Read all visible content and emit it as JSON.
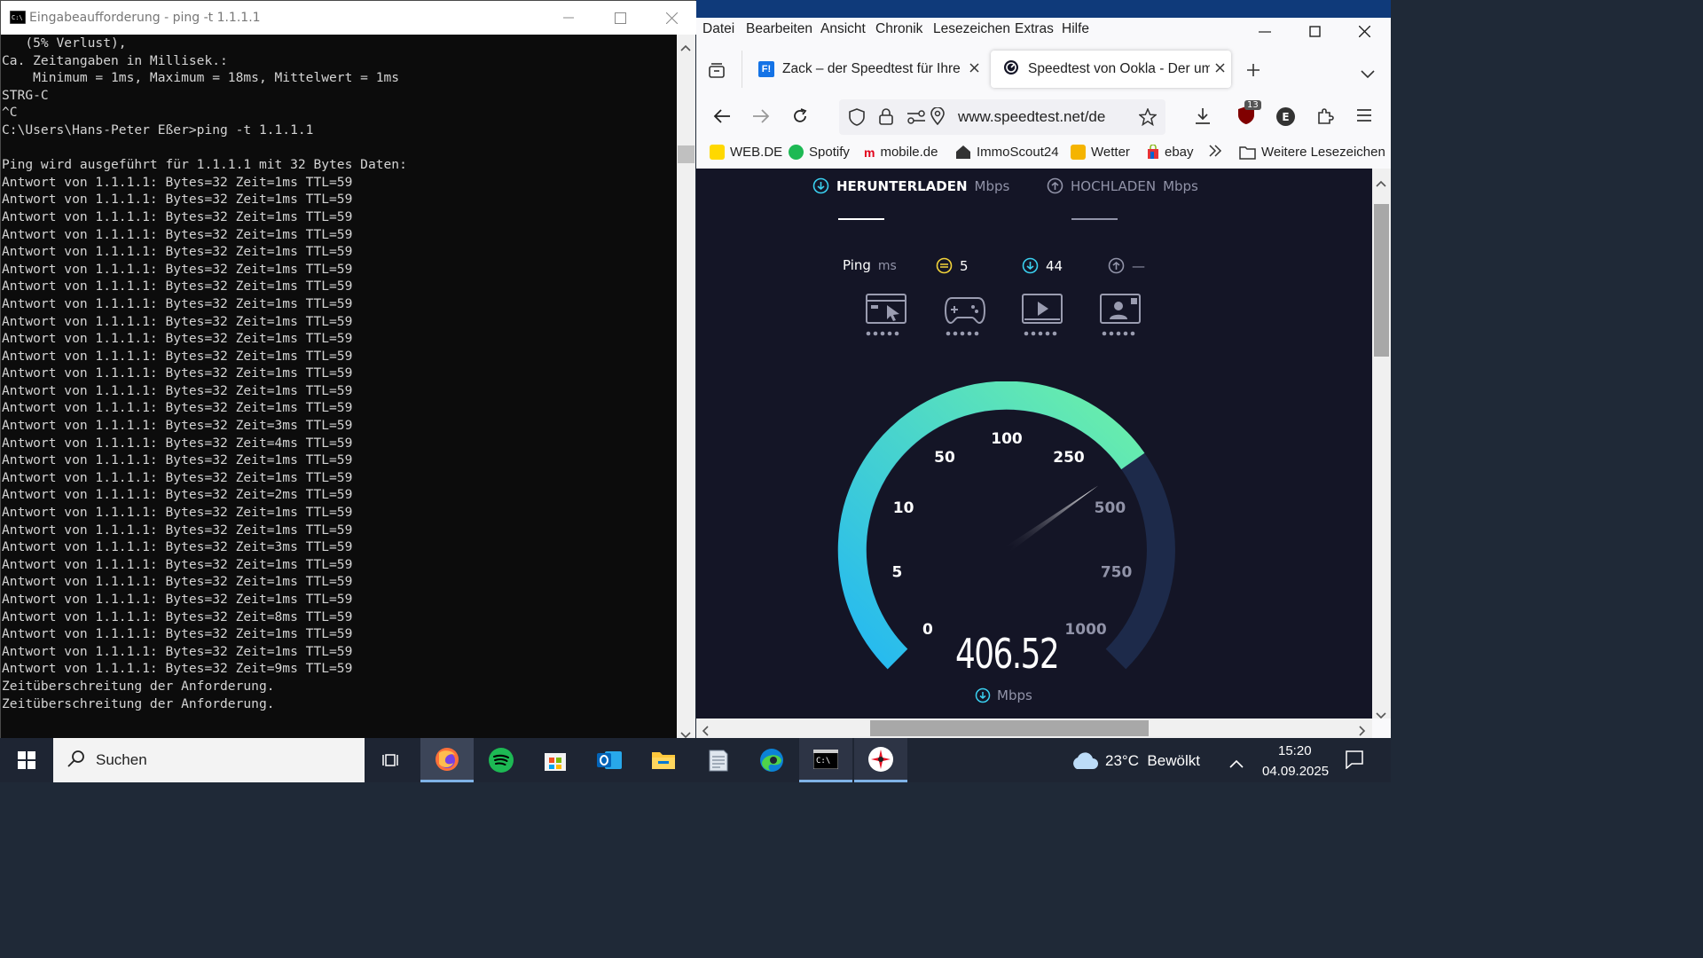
{
  "cmd": {
    "title": "Eingabeaufforderung - ping  -t 1.1.1.1",
    "lines": [
      "   (5% Verlust),",
      "Ca. Zeitangaben in Millisek.:",
      "    Minimum = 1ms, Maximum = 18ms, Mittelwert = 1ms",
      "STRG-C",
      "^C",
      "C:\\Users\\Hans-Peter Eßer>ping -t 1.1.1.1",
      "",
      "Ping wird ausgeführt für 1.1.1.1 mit 32 Bytes Daten:",
      "Antwort von 1.1.1.1: Bytes=32 Zeit=1ms TTL=59",
      "Antwort von 1.1.1.1: Bytes=32 Zeit=1ms TTL=59",
      "Antwort von 1.1.1.1: Bytes=32 Zeit=1ms TTL=59",
      "Antwort von 1.1.1.1: Bytes=32 Zeit=1ms TTL=59",
      "Antwort von 1.1.1.1: Bytes=32 Zeit=1ms TTL=59",
      "Antwort von 1.1.1.1: Bytes=32 Zeit=1ms TTL=59",
      "Antwort von 1.1.1.1: Bytes=32 Zeit=1ms TTL=59",
      "Antwort von 1.1.1.1: Bytes=32 Zeit=1ms TTL=59",
      "Antwort von 1.1.1.1: Bytes=32 Zeit=1ms TTL=59",
      "Antwort von 1.1.1.1: Bytes=32 Zeit=1ms TTL=59",
      "Antwort von 1.1.1.1: Bytes=32 Zeit=1ms TTL=59",
      "Antwort von 1.1.1.1: Bytes=32 Zeit=1ms TTL=59",
      "Antwort von 1.1.1.1: Bytes=32 Zeit=1ms TTL=59",
      "Antwort von 1.1.1.1: Bytes=32 Zeit=1ms TTL=59",
      "Antwort von 1.1.1.1: Bytes=32 Zeit=3ms TTL=59",
      "Antwort von 1.1.1.1: Bytes=32 Zeit=4ms TTL=59",
      "Antwort von 1.1.1.1: Bytes=32 Zeit=1ms TTL=59",
      "Antwort von 1.1.1.1: Bytes=32 Zeit=1ms TTL=59",
      "Antwort von 1.1.1.1: Bytes=32 Zeit=2ms TTL=59",
      "Antwort von 1.1.1.1: Bytes=32 Zeit=1ms TTL=59",
      "Antwort von 1.1.1.1: Bytes=32 Zeit=1ms TTL=59",
      "Antwort von 1.1.1.1: Bytes=32 Zeit=3ms TTL=59",
      "Antwort von 1.1.1.1: Bytes=32 Zeit=1ms TTL=59",
      "Antwort von 1.1.1.1: Bytes=32 Zeit=1ms TTL=59",
      "Antwort von 1.1.1.1: Bytes=32 Zeit=1ms TTL=59",
      "Antwort von 1.1.1.1: Bytes=32 Zeit=8ms TTL=59",
      "Antwort von 1.1.1.1: Bytes=32 Zeit=1ms TTL=59",
      "Antwort von 1.1.1.1: Bytes=32 Zeit=1ms TTL=59",
      "Antwort von 1.1.1.1: Bytes=32 Zeit=9ms TTL=59",
      "Zeitüberschreitung der Anforderung.",
      "Zeitüberschreitung der Anforderung."
    ]
  },
  "firefox": {
    "menu": [
      "Datei",
      "Bearbeiten",
      "Ansicht",
      "Chronik",
      "Lesezeichen",
      "Extras",
      "Hilfe"
    ],
    "tabs": [
      {
        "label": "Zack – der Speedtest für Ihre Br"
      },
      {
        "label": "Speedtest von Ookla - Der umfa"
      }
    ],
    "url": "www.speedtest.net/de",
    "ublock_badge": "13",
    "account_initial": "E",
    "bookmarks": [
      "WEB.DE",
      "Spotify",
      "mobile.de",
      "ImmoScout24",
      "Wetter",
      "ebay"
    ],
    "bookmarks_more": "Weitere Lesezeichen"
  },
  "speedtest": {
    "download_label": "HERUNTERLADEN",
    "download_unit": "Mbps",
    "upload_label": "HOCHLADEN",
    "upload_unit": "Mbps",
    "ping_label": "Ping",
    "ping_unit": "ms",
    "ping_idle": "5",
    "ping_download": "44",
    "ping_upload": "—",
    "gauge_labels": [
      "0",
      "5",
      "10",
      "50",
      "100",
      "250",
      "500",
      "750",
      "1000"
    ],
    "value": "406.52",
    "value_unit": "Mbps",
    "colors": {
      "gauge_start": "#29c6f2",
      "gauge_end": "#6cf0a8",
      "track": "#1d2a4a",
      "bg": "#141526"
    }
  },
  "taskbar": {
    "search_placeholder": "Suchen",
    "weather": "23°C  Bewölkt",
    "time": "15:20",
    "date": "04.09.2025"
  }
}
